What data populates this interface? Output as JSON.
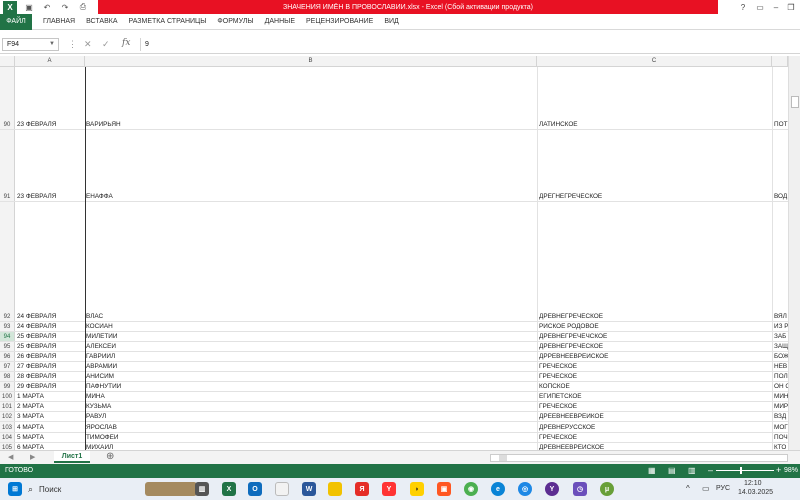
{
  "window": {
    "title": "ЗНАЧЕНИЯ ИМЁН В ПРОВОСЛАВИИ.xlsx - Excel (Сбой активации продукта)"
  },
  "ribbon": {
    "tabs": [
      "ФАЙЛ",
      "ГЛАВНАЯ",
      "ВСТАВКА",
      "РАЗМЕТКА СТРАНИЦЫ",
      "ФОРМУЛЫ",
      "ДАННЫЕ",
      "РЕЦЕНЗИРОВАНИЕ",
      "ВИД"
    ]
  },
  "formula": {
    "name_box": "F94",
    "value": "9",
    "fx": "fx"
  },
  "columns": [
    "A",
    "B",
    "C"
  ],
  "rows": [
    {
      "n": "90",
      "a": "23 ФЕВРАЛЯ",
      "b": "ВАРИРЬЯН",
      "c": "ЛАТИНСКОЕ",
      "d": "ПОТ"
    },
    {
      "n": "91",
      "a": "23 ФЕВРАЛЯ",
      "b": "ЕНАФФА",
      "c": "ДРЕГНЕГРЕЧЕСКОЕ",
      "d": "ВОД"
    },
    {
      "n": "92",
      "a": "24 ФЕВРАЛЯ",
      "b": "ВЛАС",
      "c": "ДРЕВНЕГРЕЧЕСКОЕ",
      "d": "ВЯЛ"
    },
    {
      "n": "93",
      "a": "24 ФЕВРАЛЯ",
      "b": "КОСИАН",
      "c": "РИСКОЕ РОДОВОЕ",
      "d": "ИЗ Р"
    },
    {
      "n": "94",
      "a": "25 ФЕВРАЛЯ",
      "b": "МИЛЕТИЙ",
      "c": "ДРЕВНЕГРЕЧЕЧСКОЕ",
      "d": "ЗАБ"
    },
    {
      "n": "95",
      "a": "25 ФЕВРАЛЯ",
      "b": "АЛЕКСЕЙ",
      "c": "ДРЕВНЕГРЕЧЕСКОЕ",
      "d": "ЗАЩ"
    },
    {
      "n": "96",
      "a": "26 ФЕВРАЛЯ",
      "b": "ГАВРИИЛ",
      "c": "ДРРЕВНЕЕВРЕЙСКОЕ",
      "d": "БОЖ"
    },
    {
      "n": "97",
      "a": "27 ФЕВРАЛЯ",
      "b": "АВРАМИЙ",
      "c": "ГРЕЧЕСКОЕ",
      "d": "НЕВ"
    },
    {
      "n": "98",
      "a": "28 ФЕВРАЛЯ",
      "b": "АНИСИМ",
      "c": "ГРЕЧЕСКОЕ",
      "d": "ПОЛ"
    },
    {
      "n": "99",
      "a": "29 ФЕВРАЛЯ",
      "b": "ПАФНУТИЙ",
      "c": "КОПСКОЕ",
      "d": "ОН С"
    },
    {
      "n": "100",
      "a": "1 МАРТА",
      "b": "МИНА",
      "c": "ЕГИПЕТСКОЕ",
      "d": "МИН"
    },
    {
      "n": "101",
      "a": "2 МАРТА",
      "b": "КУЗЬМА",
      "c": "ГРЕЧЕСКОЕ",
      "d": "МИР"
    },
    {
      "n": "102",
      "a": "3 МАРТА",
      "b": "РАВУЛ",
      "c": "ДРЕЕВНЕЕВРЕЙКОЕ",
      "d": "ВЗД"
    },
    {
      "n": "103",
      "a": "4 МАРТА",
      "b": "ЯРОСЛАВ",
      "c": "ДРЕВНЕРУССКОЕ",
      "d": "МОГ"
    },
    {
      "n": "104",
      "a": "5 МАРТА",
      "b": "ТИМОФЕЙ",
      "c": "ГРЕЧЕСКОЕ",
      "d": "ПОЧ"
    },
    {
      "n": "105",
      "a": "6 МАРТА",
      "b": "МИХАИЛ",
      "c": "ДРЕВНЕЕВРЕЙСКОЕ",
      "d": "КТО"
    }
  ],
  "sheet": {
    "tab": "Лист1"
  },
  "status": {
    "ready": "ГОТОВО",
    "zoom": "98%"
  },
  "taskbar": {
    "search": "Поиск",
    "lang": "РУС",
    "time": "12:10",
    "date": "14.03.2025"
  }
}
